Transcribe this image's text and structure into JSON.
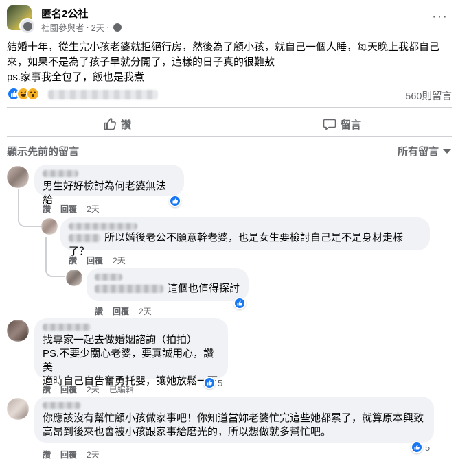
{
  "post": {
    "group_name": "匿名2公社",
    "author_role": "社團參與者",
    "separator": "·",
    "time": "2天",
    "separator2": "·",
    "text_line1": "結婚十年，從生完小孩老婆就拒絕行房，然後為了顧小孩，就自己一個人睡，每天晚上我都自己",
    "text_line2": "來，如果不是為了孩子早就分開了，這樣的日子真的很難敖",
    "text_line3": "ps.家事我全包了，飯也是我煮",
    "comment_count": "560則留言",
    "more_icon": "···"
  },
  "actions": {
    "like_label": "讚",
    "comment_label": "留言"
  },
  "comments_header": {
    "show_previous": "顯示先前的留言",
    "sort_label": "所有留言"
  },
  "comments": [
    {
      "text": "男生好好檢討為何老婆無法給",
      "like_label": "讚",
      "reply_label": "回覆",
      "time": "2天"
    },
    {
      "text": "所以婚後老公不願意幹老婆，也是女生要檢討自己是不是身材走樣了？",
      "like_label": "讚",
      "reply_label": "回覆",
      "time": "2天"
    },
    {
      "text": "這個也值得探討",
      "like_label": "讚",
      "reply_label": "回覆",
      "time": "2天"
    },
    {
      "text_line1": "找專家一起去做婚姻諮詢（拍拍）",
      "text_line2": "PS.不要少關心老婆，要真誠用心，讚美",
      "text_line3": "適時自己自告奮勇托嬰，讓她放鬆一下",
      "like_label": "讚",
      "reply_label": "回覆",
      "time": "2天",
      "edited_label": "已編輯",
      "reaction_count": "5"
    },
    {
      "text_line1": "你應該沒有幫忙顧小孩做家事吧！你知道當妳老婆忙完這些她都累了，就算原本興致",
      "text_line2": "高昂到後來也會被小孩跟家事給磨光的，所以想做就多幫忙吧。",
      "like_label": "讚",
      "reply_label": "回覆",
      "time": "2天",
      "reaction_count": "5"
    }
  ],
  "colors": {
    "facebook_blue": "#1877f2",
    "secondary_text": "#65676b",
    "bubble_bg": "#f0f2f5",
    "reaction_yellow": "#f7b125"
  }
}
